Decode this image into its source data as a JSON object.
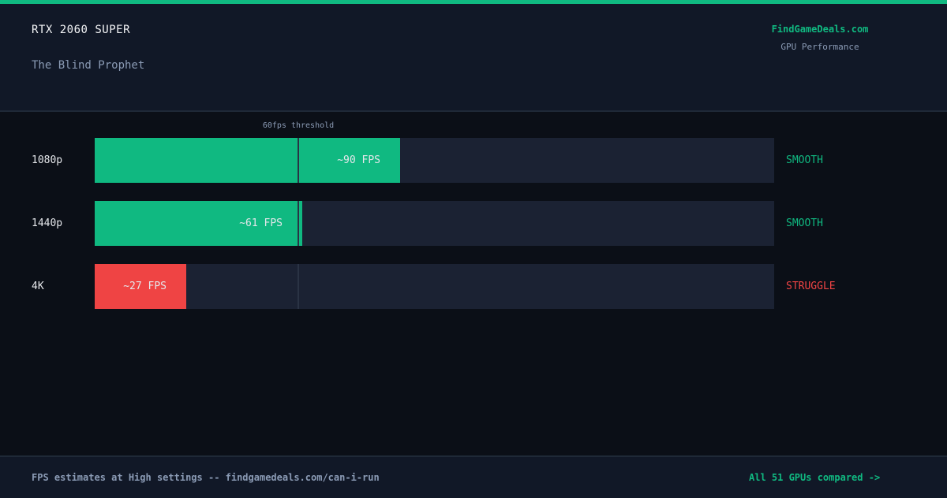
{
  "header": {
    "gpu_name": "RTX 2060 SUPER",
    "game_name": "The Blind Prophet",
    "brand": "FindGameDeals.com",
    "brand_subtitle": "GPU Performance"
  },
  "colors": {
    "smooth": "#10b981",
    "struggle": "#ef4444",
    "track": "#1b2233"
  },
  "chart_data": {
    "type": "bar",
    "orientation": "horizontal",
    "x_max_fps": 200,
    "threshold": {
      "value": 60,
      "label": "60fps threshold"
    },
    "categories": [
      "1080p",
      "1440p",
      "4K"
    ],
    "values": [
      90,
      61,
      27
    ],
    "bars": [
      {
        "resolution": "1080p",
        "fps": 90,
        "fps_label": "~90 FPS",
        "status": "SMOOTH",
        "color": "#10b981"
      },
      {
        "resolution": "1440p",
        "fps": 61,
        "fps_label": "~61 FPS",
        "status": "SMOOTH",
        "color": "#10b981"
      },
      {
        "resolution": "4K",
        "fps": 27,
        "fps_label": "~27 FPS",
        "status": "STRUGGLE",
        "color": "#ef4444"
      }
    ]
  },
  "footer": {
    "note": "FPS estimates at High settings -- findgamedeals.com/can-i-run",
    "link": "All 51 GPUs compared ->"
  }
}
